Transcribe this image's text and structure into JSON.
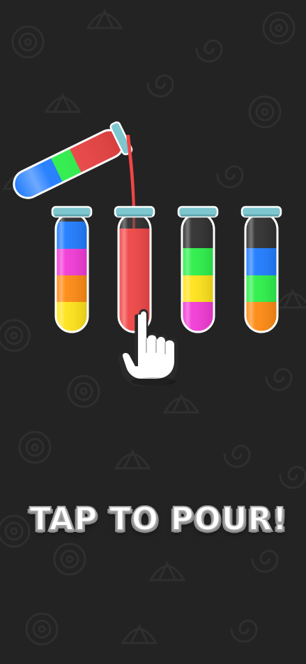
{
  "instruction": {
    "text": "TAP TO POUR!"
  },
  "colors": {
    "background": "#232323",
    "pattern": "#2e2e2e",
    "tube_rim": "#7fc7cf",
    "tube_rim_dark": "#3f8a94",
    "blue": "#1f7bff",
    "magenta": "#f23ad6",
    "orange": "#ff8a12",
    "yellow": "#ffe319",
    "red": "#f04545",
    "green": "#2cf04a",
    "hand_fill": "#ffffff",
    "hand_outline": "#2a2a2a"
  },
  "pouring_tube": {
    "layers_bottom_to_top": [
      "blue",
      "green",
      "red"
    ]
  },
  "tubes": [
    {
      "name": "tube-1",
      "layers_bottom_to_top": [
        "yellow",
        "orange",
        "magenta",
        "blue"
      ]
    },
    {
      "name": "tube-2",
      "layers_bottom_to_top": [
        "red"
      ],
      "receiving_pour": true
    },
    {
      "name": "tube-3",
      "layers_bottom_to_top": [
        "magenta",
        "yellow",
        "green"
      ]
    },
    {
      "name": "tube-4",
      "layers_bottom_to_top": [
        "orange",
        "green",
        "blue"
      ]
    }
  ],
  "icons": {
    "pointer": "tap-hand-icon"
  }
}
